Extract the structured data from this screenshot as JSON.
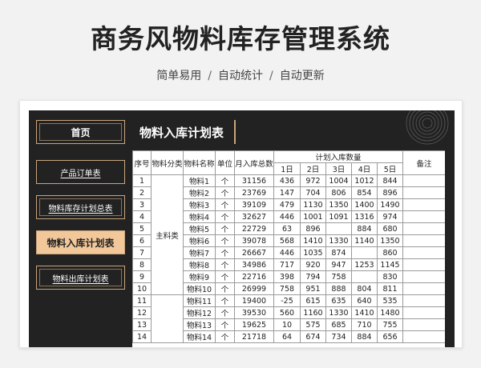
{
  "header": {
    "title": "商务风物料库存管理系统",
    "subtitle": [
      "简单易用",
      "自动统计",
      "自动更新"
    ],
    "separator": "/"
  },
  "nav": {
    "home": "首页",
    "items": [
      "产品订单表",
      "物料库存计划总表",
      "物料入库计划表",
      "物料出库计划表"
    ],
    "active_index": 2
  },
  "section_title": "物料入库计划表",
  "table": {
    "headers": {
      "seq": "序号",
      "category": "物料分类",
      "name": "物料名称",
      "unit": "单位",
      "monthly_total": "月入库总数",
      "planned_group": "计划入库数量",
      "days": [
        "1日",
        "2日",
        "3日",
        "4日",
        "5日"
      ],
      "remark": "备注"
    },
    "category_label": "主料类",
    "rows": [
      [
        "1",
        "物料1",
        "个",
        "31156",
        "436",
        "972",
        "1004",
        "1012",
        "844",
        ""
      ],
      [
        "2",
        "物料2",
        "个",
        "23769",
        "147",
        "704",
        "806",
        "854",
        "896",
        ""
      ],
      [
        "3",
        "物料3",
        "个",
        "39109",
        "479",
        "1130",
        "1350",
        "1400",
        "1490",
        ""
      ],
      [
        "4",
        "物料4",
        "个",
        "32627",
        "446",
        "1001",
        "1091",
        "1316",
        "974",
        ""
      ],
      [
        "5",
        "物料5",
        "个",
        "22729",
        "63",
        "896",
        "",
        "884",
        "680",
        ""
      ],
      [
        "6",
        "物料6",
        "个",
        "39078",
        "568",
        "1410",
        "1330",
        "1140",
        "1350",
        ""
      ],
      [
        "7",
        "物料7",
        "个",
        "26667",
        "446",
        "1035",
        "874",
        "",
        "860",
        ""
      ],
      [
        "8",
        "物料8",
        "个",
        "34986",
        "717",
        "920",
        "947",
        "1253",
        "1145",
        ""
      ],
      [
        "9",
        "物料9",
        "个",
        "22716",
        "398",
        "794",
        "758",
        "",
        "830",
        ""
      ],
      [
        "10",
        "物料10",
        "个",
        "26999",
        "758",
        "951",
        "888",
        "804",
        "811",
        ""
      ],
      [
        "11",
        "物料11",
        "个",
        "19400",
        "-25",
        "615",
        "635",
        "640",
        "535",
        ""
      ],
      [
        "12",
        "物料12",
        "个",
        "39530",
        "560",
        "1160",
        "1330",
        "1410",
        "1480",
        ""
      ],
      [
        "13",
        "物料13",
        "个",
        "19625",
        "10",
        "575",
        "685",
        "710",
        "755",
        ""
      ],
      [
        "14",
        "物料14",
        "个",
        "21718",
        "64",
        "674",
        "734",
        "884",
        "656",
        ""
      ]
    ]
  },
  "colors": {
    "dark_bg": "#222222",
    "accent_gold": "#c9a57c",
    "active_fill": "#f2c89b"
  }
}
